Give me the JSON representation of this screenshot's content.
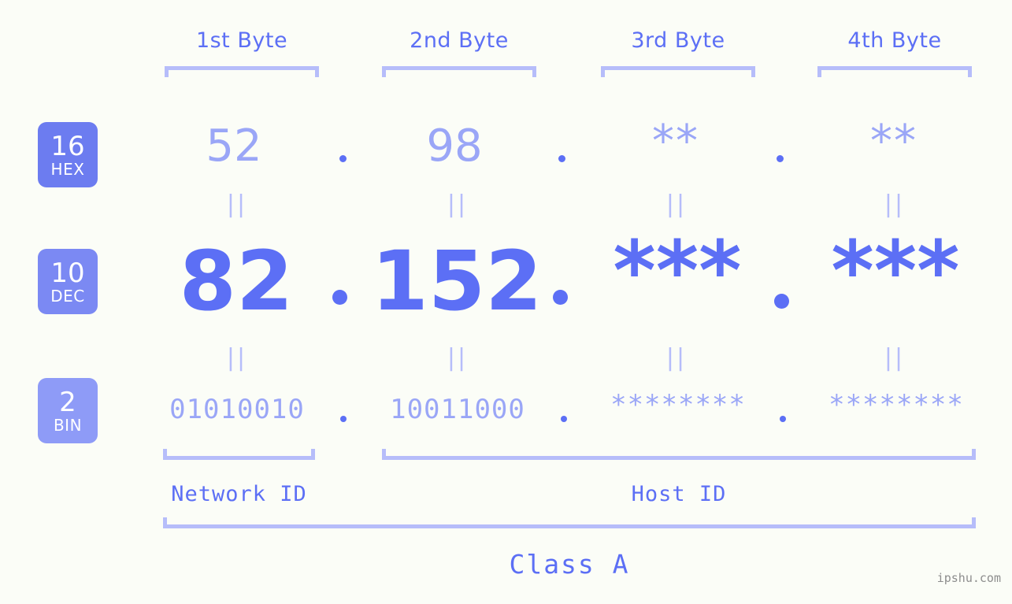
{
  "bg_color": "#fbfdf7",
  "accent_strong": "#5c6ff5",
  "accent_muted": "#9aa6f7",
  "bracket_color": "#b6bdfa",
  "headers": {
    "byte1": "1st Byte",
    "byte2": "2nd Byte",
    "byte3": "3rd Byte",
    "byte4": "4th Byte"
  },
  "bases": [
    {
      "num": "16",
      "name": "HEX",
      "color": "#6c7cf0"
    },
    {
      "num": "10",
      "name": "DEC",
      "color": "#7b89f3"
    },
    {
      "num": "2",
      "name": "BIN",
      "color": "#8e9bf7"
    }
  ],
  "rows": {
    "hex": {
      "label_num": "16",
      "label_name": "HEX",
      "values": [
        "52",
        "98",
        "**",
        "**"
      ],
      "separator": "."
    },
    "dec": {
      "label_num": "10",
      "label_name": "DEC",
      "values": [
        "82",
        "152",
        "***",
        "***"
      ],
      "separator": "."
    },
    "bin": {
      "label_num": "2",
      "label_name": "BIN",
      "values": [
        "01010010",
        "10011000",
        "********",
        "********"
      ],
      "separator": "."
    }
  },
  "connectors": {
    "symbol": "||",
    "count_per_row": 4
  },
  "footer": {
    "network_id": "Network ID",
    "host_id": "Host ID",
    "class": "Class A",
    "watermark": "ipshu.com"
  }
}
